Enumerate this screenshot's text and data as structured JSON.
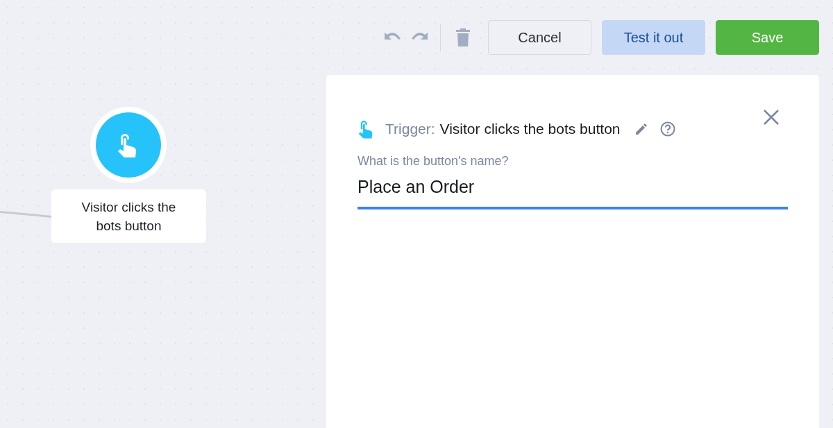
{
  "toolbar": {
    "buttons": [
      {
        "label": "Cancel",
        "kind": "secondary"
      },
      {
        "label": "Test it out",
        "kind": "test"
      },
      {
        "label": "Save",
        "kind": "primary"
      }
    ]
  },
  "node": {
    "label": "Visitor clicks the bots button"
  },
  "panel": {
    "trigger_prefix": "Trigger:",
    "trigger_title": "Visitor clicks the bots button",
    "field": {
      "label": "What is the button's name?",
      "value": "Place an Order"
    }
  }
}
